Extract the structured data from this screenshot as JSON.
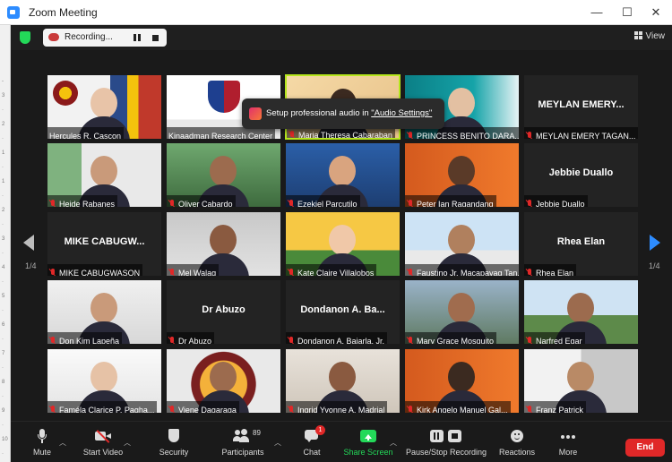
{
  "window": {
    "title": "Zoom Meeting",
    "minimize": "—",
    "maximize": "☐",
    "close": "✕"
  },
  "topbar": {
    "recording_label": "Recording...",
    "view_label": "View"
  },
  "ruler": [
    "-",
    "3",
    "·",
    "2",
    "·",
    "1",
    "·",
    "1",
    "·",
    "2",
    "·",
    "3",
    "·",
    "4",
    "·",
    "5",
    "·",
    "6",
    "·",
    "7",
    "·",
    "8",
    "·",
    "9",
    "·",
    "10",
    "·"
  ],
  "pagination": {
    "left": "1/4",
    "right": "1/4"
  },
  "toast": {
    "text": "Setup professional audio in ",
    "link": "\"Audio Settings\""
  },
  "participants": [
    {
      "name": "Hercules R. Cascon",
      "big": ""
    },
    {
      "name": "Kinaadman Research Center",
      "big": ""
    },
    {
      "name": "Maria Theresa Cabaraban",
      "big": ""
    },
    {
      "name": "PRINCESS BENITO DARA...",
      "big": ""
    },
    {
      "name": "MEYLAN EMERY TAGAN...",
      "big": "MEYLAN  EMERY..."
    },
    {
      "name": "Heide Rabanes",
      "big": ""
    },
    {
      "name": "Oliver Cabardo",
      "big": ""
    },
    {
      "name": "Ezekiel Parcutilo",
      "big": ""
    },
    {
      "name": "Peter Ian Ragandang",
      "big": ""
    },
    {
      "name": "Jebbie Duallo",
      "big": "Jebbie Duallo"
    },
    {
      "name": "MIKE CABUGWASON",
      "big": "MIKE CABUGW..."
    },
    {
      "name": "Mel Walag",
      "big": ""
    },
    {
      "name": "Kate Claire Villalobos",
      "big": ""
    },
    {
      "name": "Faustino Jr. Macapayag Tan...",
      "big": ""
    },
    {
      "name": "Rhea Elan",
      "big": "Rhea Elan"
    },
    {
      "name": "Don Kim Lapeña",
      "big": ""
    },
    {
      "name": "Dr Abuzo",
      "big": "Dr Abuzo"
    },
    {
      "name": "Dondanon A. Bajarla, Jr.",
      "big": "Dondanon  A.  Ba..."
    },
    {
      "name": "Mary Grace Mosquito",
      "big": ""
    },
    {
      "name": "Narfred Egar",
      "big": ""
    },
    {
      "name": "Faméla Clarice P. Pagha...",
      "big": ""
    },
    {
      "name": "Viene Dagaraga",
      "big": ""
    },
    {
      "name": "Ingrid Yvonne A. Madrial",
      "big": ""
    },
    {
      "name": "Kirk Angelo Manuel Gal...",
      "big": ""
    },
    {
      "name": "Franz Patrick",
      "big": ""
    }
  ],
  "toolbar": {
    "mute": "Mute",
    "start_video": "Start Video",
    "security": "Security",
    "participants": "Participants",
    "participants_count": "89",
    "chat": "Chat",
    "chat_badge": "1",
    "share_screen": "Share Screen",
    "recording": "Pause/Stop Recording",
    "reactions": "Reactions",
    "more": "More",
    "end": "End"
  },
  "colors": {
    "accent": "#2d8cff",
    "share": "#23d959",
    "end": "#e02828",
    "active_speaker": "#b5e61d"
  }
}
